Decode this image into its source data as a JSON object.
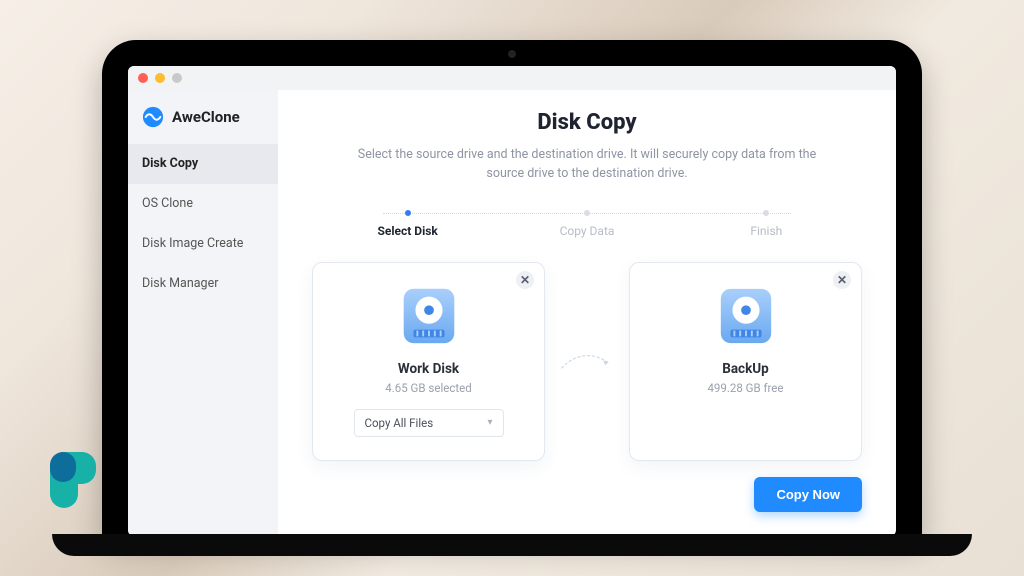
{
  "brand": {
    "name": "AweClone"
  },
  "sidebar": {
    "items": [
      {
        "label": "Disk Copy",
        "active": true
      },
      {
        "label": "OS Clone",
        "active": false
      },
      {
        "label": "Disk Image Create",
        "active": false
      },
      {
        "label": "Disk Manager",
        "active": false
      }
    ]
  },
  "page": {
    "title": "Disk Copy",
    "subtitle": "Select the source drive and the destination drive. It will securely copy data from the source drive to the destination drive."
  },
  "steps": [
    {
      "label": "Select Disk",
      "active": true
    },
    {
      "label": "Copy Data",
      "active": false
    },
    {
      "label": "Finish",
      "active": false
    }
  ],
  "source": {
    "name": "Work Disk",
    "subtitle": "4.65 GB selected",
    "mode_selected": "Copy All Files"
  },
  "destination": {
    "name": "BackUp",
    "subtitle": "499.28 GB free"
  },
  "actions": {
    "primary": "Copy Now"
  },
  "colors": {
    "accent": "#1f8bff"
  }
}
